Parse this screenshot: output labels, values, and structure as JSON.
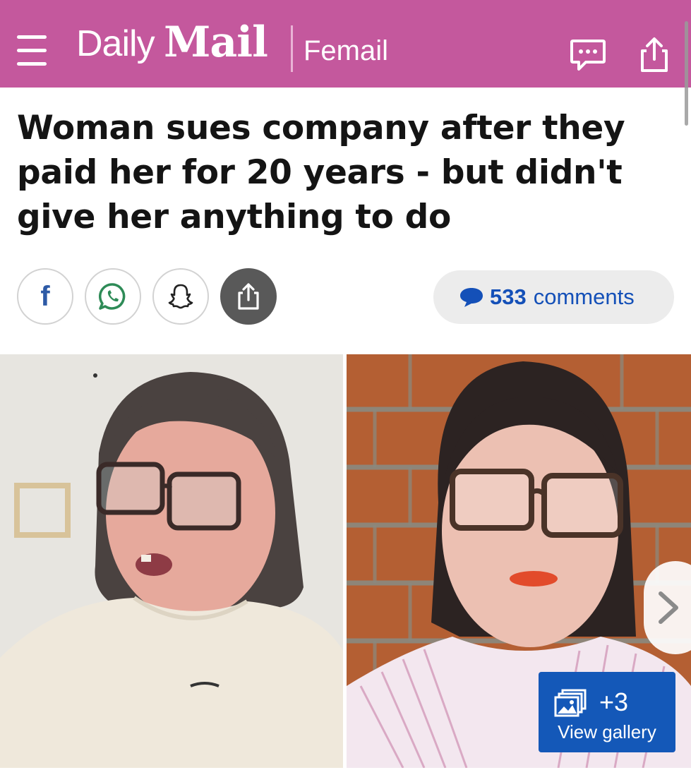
{
  "header": {
    "logo_daily": "Daily",
    "logo_mail": "Mail",
    "section": "Femail",
    "menu_icon": "hamburger-icon",
    "comment_icon": "comment-bubble-icon",
    "share_icon": "share-icon",
    "background_color": "#c4589d"
  },
  "article": {
    "headline": "Woman sues company after they paid her for 20 years - but didn't give her anything to do"
  },
  "share_bar": {
    "facebook_glyph": "f",
    "buttons": [
      "facebook-icon",
      "whatsapp-icon",
      "snapchat-icon",
      "share-icon"
    ],
    "comments_count": "533",
    "comments_word": "comments",
    "accent_color": "#1450b8"
  },
  "gallery": {
    "extra_count": "+3",
    "view_label": "View gallery",
    "button_color": "#1458b8",
    "next_icon": "chevron-right-icon"
  }
}
